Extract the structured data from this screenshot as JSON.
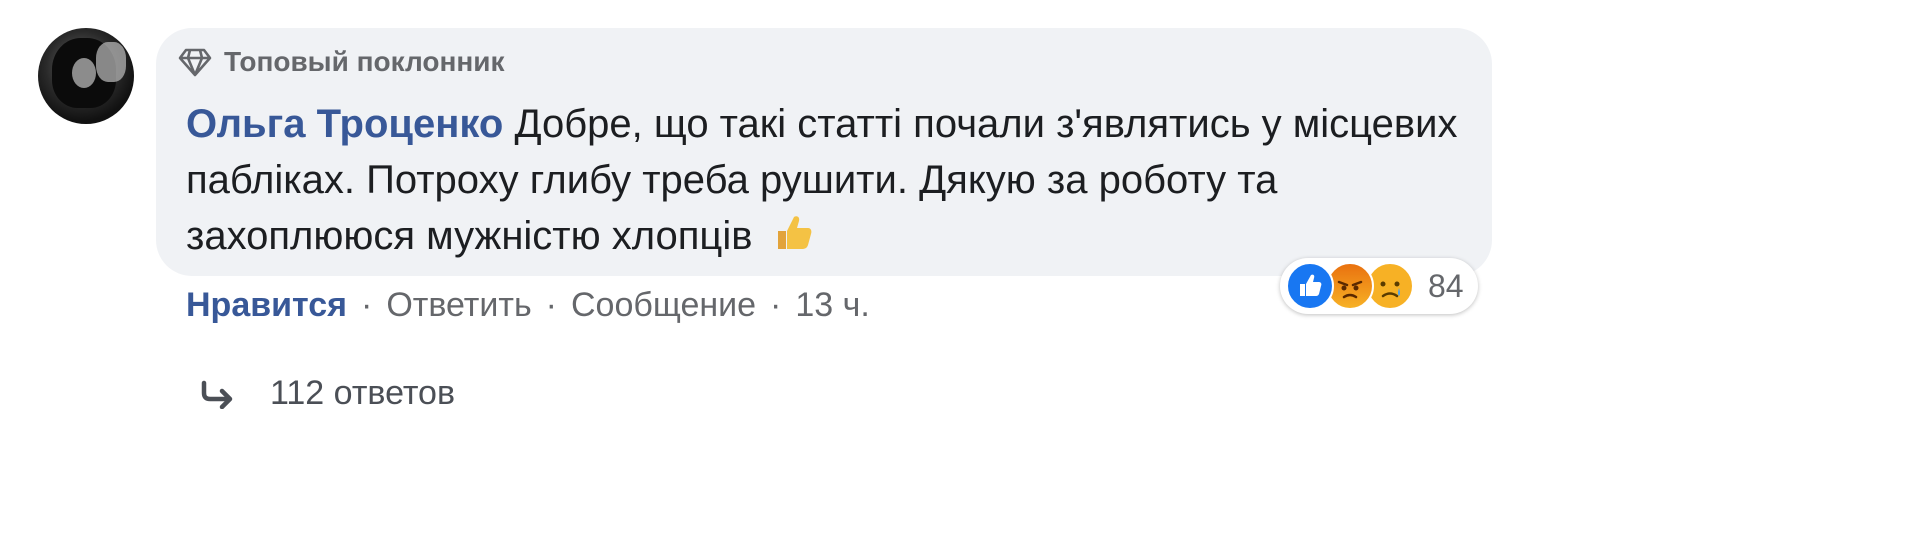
{
  "comment": {
    "badge_label": "Топовый поклонник",
    "author": "Ольга Троценко",
    "text": "Добре, що такі статті почали з'являтись у місцевих пабліках. Потроху глибу треба рушити. Дякую за роботу та захоплююся мужністю хлопців",
    "reactions": {
      "icons": [
        "like-icon",
        "angry-icon",
        "sad-icon"
      ],
      "count": "84"
    },
    "actions": {
      "like_label": "Нравится",
      "reply_label": "Ответить",
      "message_label": "Сообщение",
      "separator": "·",
      "time": "13 ч."
    },
    "replies_label": "112 ответов"
  },
  "colors": {
    "bubble_bg": "#f0f2f5",
    "author": "#385898",
    "secondary_text": "#65676b",
    "like_blue": "#1877f2"
  }
}
